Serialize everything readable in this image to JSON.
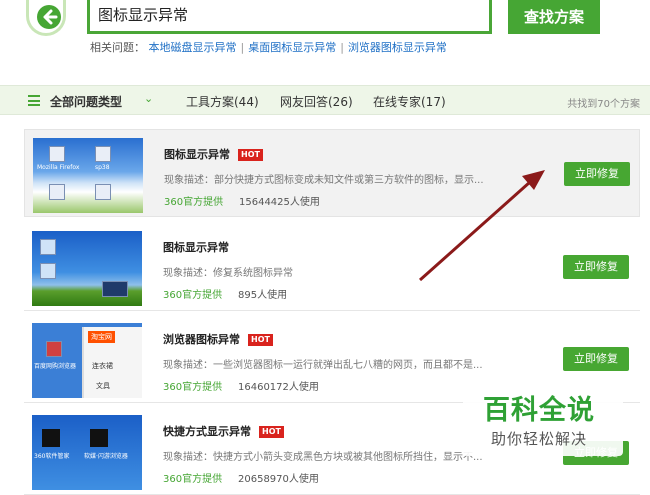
{
  "search": {
    "query": "图标显示异常",
    "button_label": "查找方案"
  },
  "related": {
    "label": "相关问题：",
    "items": [
      "本地磁盘显示异常",
      "桌面图标显示异常",
      "浏览器图标显示异常"
    ]
  },
  "filter": {
    "all_label": "全部问题类型",
    "tabs": [
      "工具方案(44)",
      "网友回答(26)",
      "在线专家(17)"
    ],
    "found": "共找到70个方案"
  },
  "results": [
    {
      "title": "图标显示异常",
      "hot": "HOT",
      "desc": "现象描述：部分快捷方式图标变成未知文件或第三方软件的图标，显示...",
      "source": "360官方提供",
      "users": "15644425人使用",
      "button": "立即修复",
      "thumb_labels": [
        "Mozilla Firefox",
        "sp38",
        "",
        ""
      ]
    },
    {
      "title": "图标显示异常",
      "hot": "",
      "desc": "现象描述：修复系统图标异常",
      "source": "360官方提供",
      "users": "895人使用",
      "button": "立即修复"
    },
    {
      "title": "浏览器图标异常",
      "hot": "HOT",
      "desc": "现象描述：一些浏览器图标一运行就弹出乱七八糟的网页，而且都不是...",
      "source": "360官方提供",
      "users": "16460172人使用",
      "button": "立即修复",
      "thumb_labels": [
        "淘宝网",
        "连衣裙",
        "文具",
        "百度网购浏览器"
      ]
    },
    {
      "title": "快捷方式显示异常",
      "hot": "HOT",
      "desc": "现象描述：快捷方式小箭头变成黑色方块或被其他图标所挡住，显示不...",
      "source": "360官方提供",
      "users": "20658970人使用",
      "button": "立即修复",
      "thumb_labels": [
        "360软件管家",
        "软媒·闪游浏览器"
      ]
    }
  ],
  "watermark": {
    "title": "百科全说",
    "subtitle": "助你轻松解决"
  },
  "colors": {
    "brand_green": "#46a634",
    "hot_red": "#d9231d",
    "link_blue": "#1e6fc5",
    "arrow": "#8b1a1a"
  }
}
